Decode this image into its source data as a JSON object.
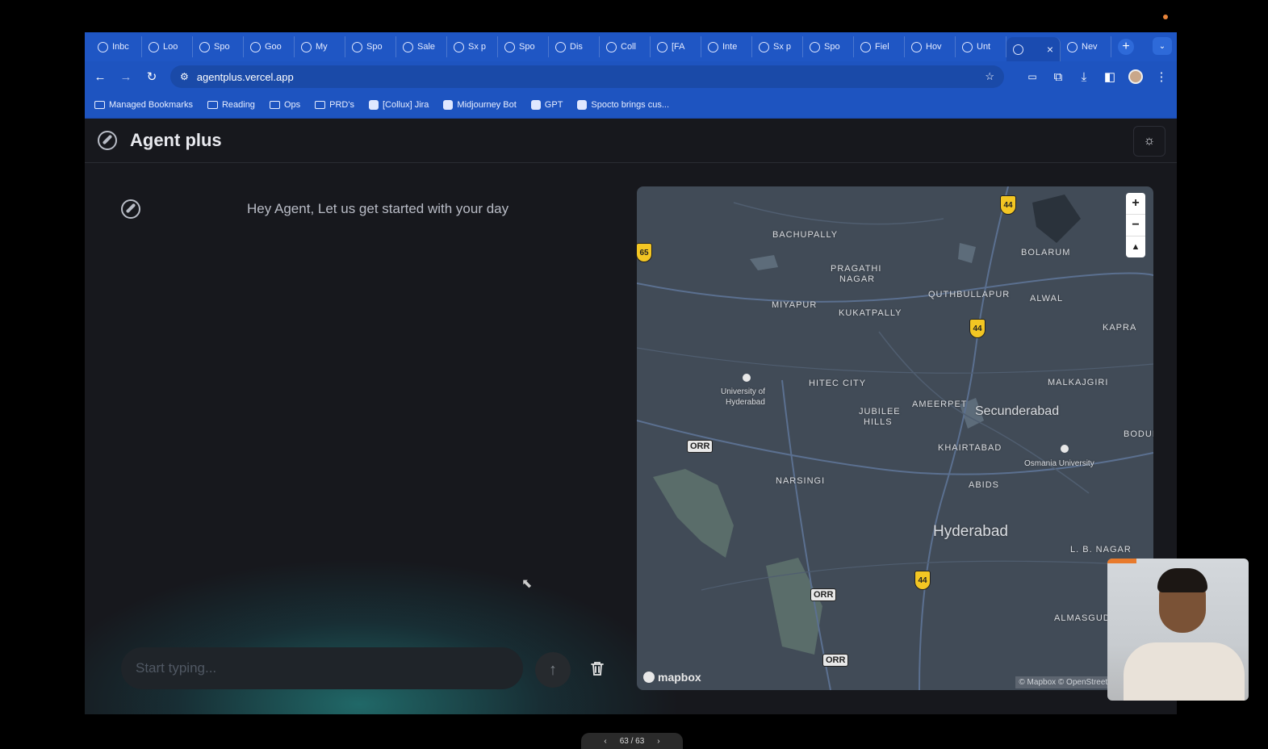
{
  "tabs": [
    {
      "label": "Inbc",
      "icon": "gmail-icon"
    },
    {
      "label": "Loo",
      "icon": "calendar-icon"
    },
    {
      "label": "Spo",
      "icon": "doc-icon"
    },
    {
      "label": "Goo",
      "icon": "openai-icon"
    },
    {
      "label": "My",
      "icon": "openai-icon"
    },
    {
      "label": "Spo",
      "icon": "openai-icon"
    },
    {
      "label": "Sale",
      "icon": "openai-icon"
    },
    {
      "label": "Sx p",
      "icon": "openai-icon"
    },
    {
      "label": "Spo",
      "icon": "openai-icon"
    },
    {
      "label": "Dis",
      "icon": "openai-icon"
    },
    {
      "label": "Coll",
      "icon": "sheets-icon"
    },
    {
      "label": "[FA",
      "icon": "jira-icon"
    },
    {
      "label": "Inte",
      "icon": "app-icon"
    },
    {
      "label": "Sx p",
      "icon": "openai-icon"
    },
    {
      "label": "Spo",
      "icon": "openai-icon"
    },
    {
      "label": "Fiel",
      "icon": "confluence-icon"
    },
    {
      "label": "Hov",
      "icon": "app-icon"
    },
    {
      "label": "Unt",
      "icon": "sheets-icon"
    }
  ],
  "active_tab": {
    "close": "×"
  },
  "last_tab": {
    "label": "Nev"
  },
  "new_tab": "+",
  "address": {
    "url": "agentplus.vercel.app"
  },
  "bookmarks": [
    {
      "label": "Managed Bookmarks"
    },
    {
      "label": "Reading"
    },
    {
      "label": "Ops"
    },
    {
      "label": "PRD's"
    },
    {
      "label": "[Collux] Jira"
    },
    {
      "label": "Midjourney Bot"
    },
    {
      "label": "GPT"
    },
    {
      "label": "Spocto brings cus..."
    }
  ],
  "app": {
    "title": "Agent plus"
  },
  "chat": {
    "greeting": "Hey Agent, Let us get started with your day",
    "input_placeholder": "Start typing..."
  },
  "map": {
    "labels": {
      "bachupally": "BACHUPALLY",
      "pragathi": "PRAGATHI",
      "nagar": "NAGAR",
      "bolarum": "BOLARUM",
      "quthbullapur": "QUTHBULLAPUR",
      "alwal": "ALWAL",
      "miyapur": "MIYAPUR",
      "kukatpally": "KUKATPALLY",
      "kapra": "KAPRA",
      "hitec": "HITEC CITY",
      "malkajgiri": "MALKAJGIRI",
      "university": "University of",
      "university2": "Hyderabad",
      "jubilee": "JUBILEE",
      "hills": "HILLS",
      "ameerpet": "AMEERPET",
      "secunderabad": "Secunderabad",
      "bodu": "BODUI",
      "khairtabad": "KHAIRTABAD",
      "osmania": "Osmania University",
      "narsingi": "NARSINGI",
      "abids": "ABIDS",
      "hyderabad": "Hyderabad",
      "lbnagar": "L. B. NAGAR",
      "almasguda": "ALMASGUDA"
    },
    "shields": [
      "44",
      "65",
      "44",
      "44"
    ],
    "orr": "ORR",
    "logo": "mapbox",
    "attribution": "© Mapbox © OpenStreetMap  Improv"
  },
  "pager": {
    "text": "63 / 63"
  }
}
